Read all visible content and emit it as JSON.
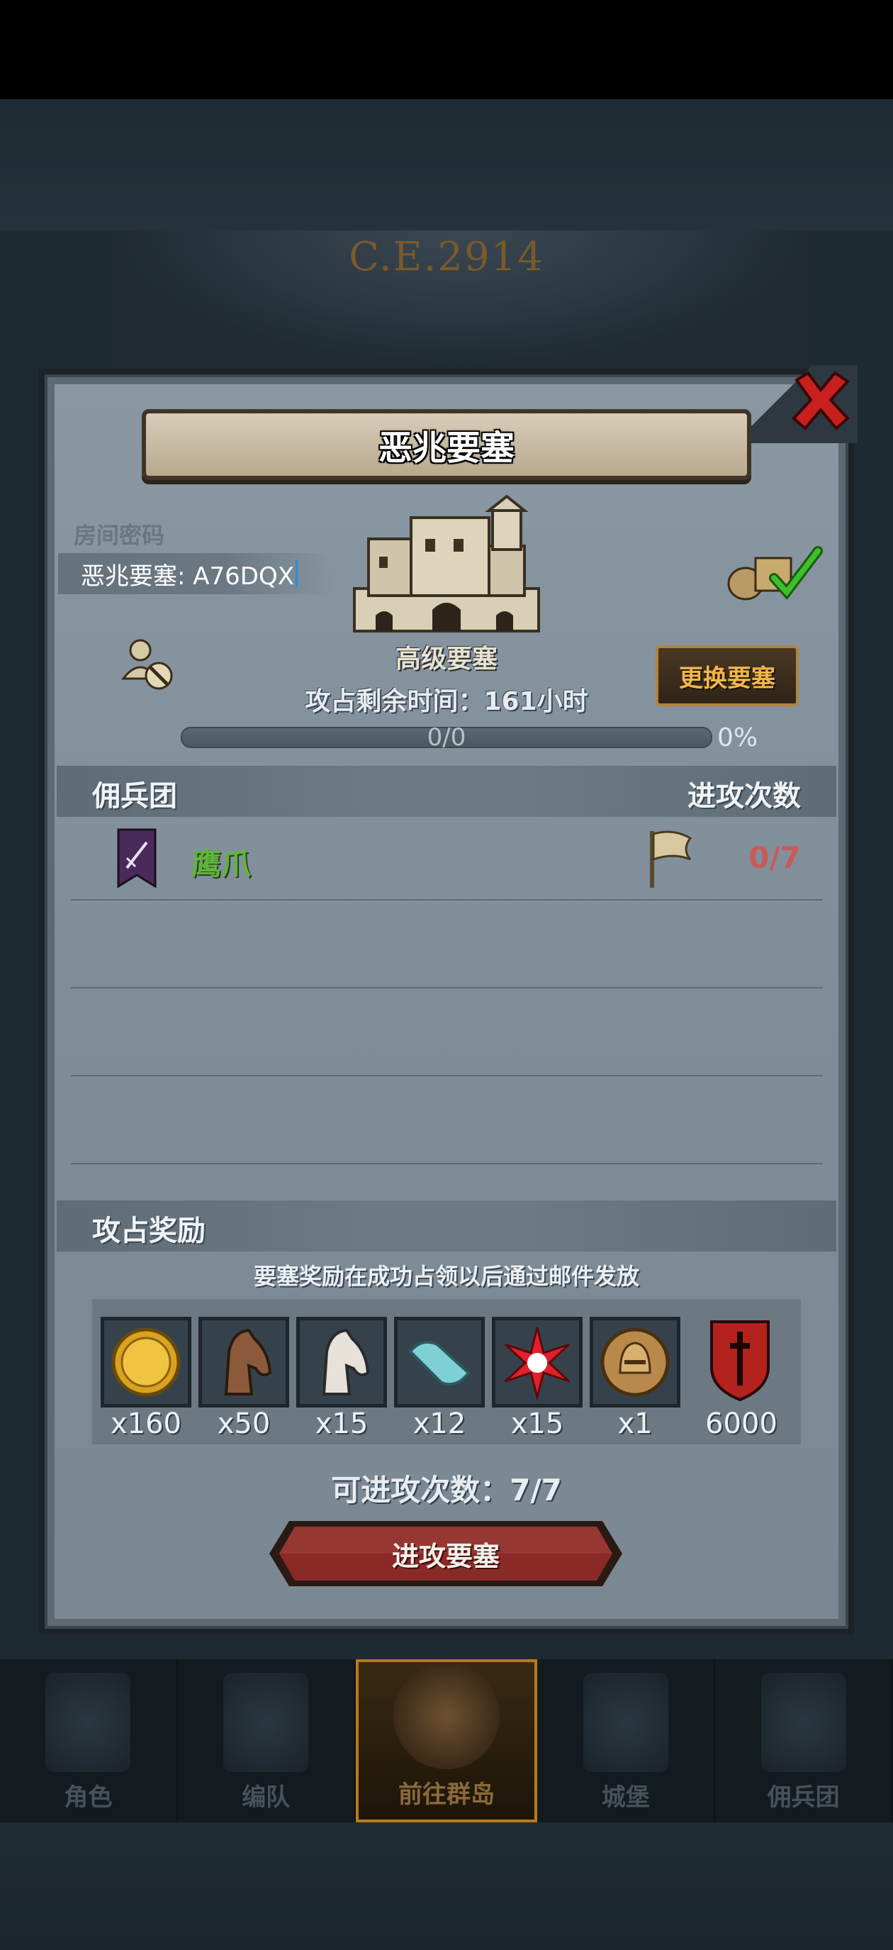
{
  "background": {
    "year": "C.E.2914"
  },
  "dialog": {
    "title": "恶兆要塞",
    "room_password_label": "房间密码",
    "room_password_value": "恶兆要塞: A76DQX",
    "fortress_level": "高级要塞",
    "change_fortress_button": "更换要塞",
    "capture_time_remaining": "攻占剩余时间：161小时",
    "progress": {
      "text": "0/0",
      "percent_label": "0%",
      "fraction": 0
    },
    "mercenary_header": "佣兵团",
    "attack_count_header": "进攻次数",
    "mercenaries": [
      {
        "name": "鹰爪",
        "attacks": "0/7"
      }
    ],
    "rewards_header": "攻占奖励",
    "rewards_note": "要塞奖励在成功占领以后通过邮件发放",
    "rewards": [
      {
        "icon": "gold-coin-icon",
        "qty": "x160"
      },
      {
        "icon": "brown-horse-icon",
        "qty": "x50"
      },
      {
        "icon": "white-horse-icon",
        "qty": "x15"
      },
      {
        "icon": "cloth-bolt-icon",
        "qty": "x12"
      },
      {
        "icon": "red-star-icon",
        "qty": "x15"
      },
      {
        "icon": "knight-helmet-icon",
        "qty": "x1"
      },
      {
        "icon": "guild-emblem-icon",
        "qty": "6000"
      }
    ],
    "attacks_available": "可进攻次数：7/7",
    "attack_button": "进攻要塞"
  },
  "nav": {
    "items": [
      "角色",
      "编队",
      "前往群岛",
      "城堡",
      "佣兵团"
    ],
    "active_index": 2
  },
  "colors": {
    "merc_name": "#5fb63a",
    "attack_count": "#c95a5a",
    "change_button_text": "#f2b648",
    "attack_button": "#8a2a26"
  }
}
